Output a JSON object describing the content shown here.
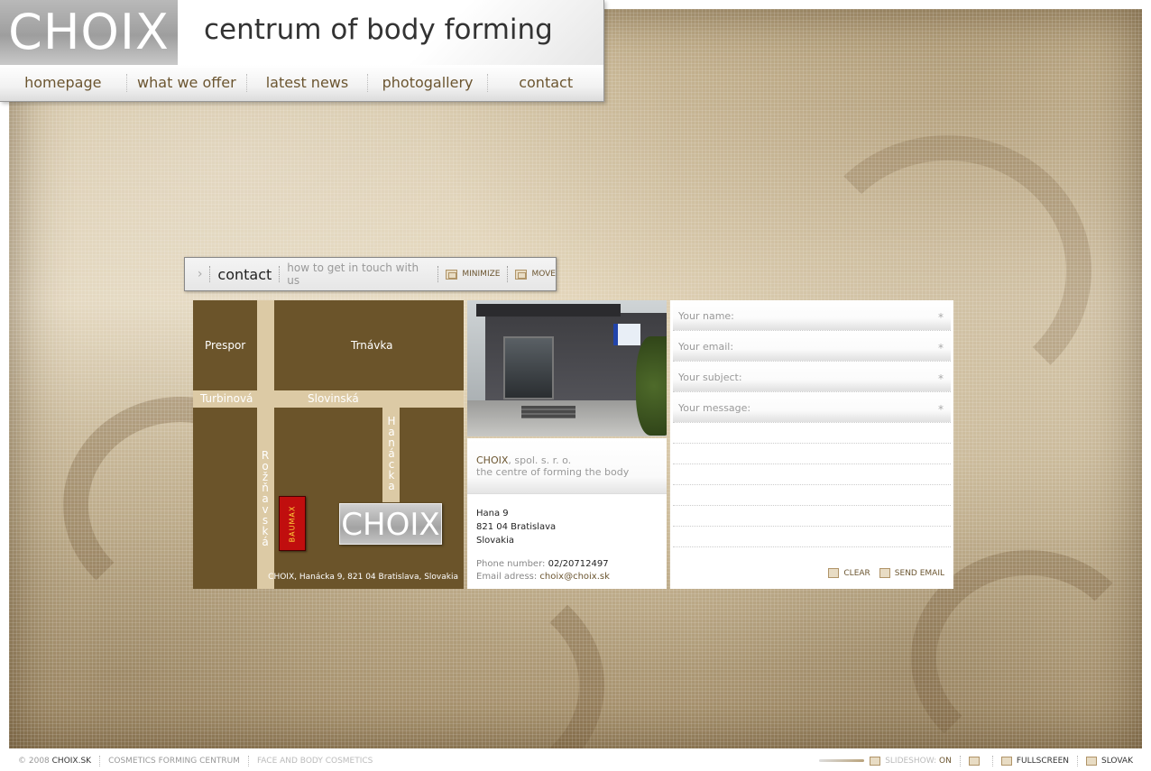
{
  "header": {
    "logo": "CHOIX",
    "tagline": "centrum of body forming"
  },
  "nav": {
    "items": [
      "homepage",
      "what we offer",
      "latest news",
      "photogallery",
      "contact"
    ]
  },
  "panel": {
    "title": "contact",
    "subtitle": "how to get in touch with us",
    "minimize_label": "MINIMIZE",
    "move_label": "MOVE"
  },
  "map": {
    "areas": [
      "Prespor",
      "Trnávka"
    ],
    "streets": [
      "Turbinová",
      "Slovinská",
      "Hanácka",
      "Rožňavská"
    ],
    "baumax": "BAUMAX",
    "logo": "CHOIX",
    "address": "CHOIX, Hanácka 9, 821 04 Bratislava, Slovakia"
  },
  "info": {
    "brand": "CHOIX",
    "company_suffix": ", spol. s. r. o.",
    "slogan": "the centre of forming the body",
    "street": "Hana 9",
    "city": "821 04 Bratislava",
    "country": "Slovakia",
    "phone_label": "Phone number:",
    "phone": "02/20712497",
    "email_label": "Email adress:",
    "email": "choix@choix.sk"
  },
  "form": {
    "name_placeholder": "Your name:",
    "email_placeholder": "Your email:",
    "subject_placeholder": "Your subject:",
    "message_placeholder": "Your message:",
    "required_mark": "*",
    "clear_label": "CLEAR",
    "send_label": "SEND EMAIL"
  },
  "footer": {
    "copyright": "© 2008",
    "site": "CHOIX.SK",
    "link1": "COSMETICS FORMING CENTRUM",
    "link2": "FACE AND BODY COSMETICS",
    "slideshow_label": "SLIDESHOW:",
    "slideshow_state": "ON",
    "fullscreen_label": "FULLSCREEN",
    "language_label": "SLOVAK"
  },
  "colors": {
    "accent_brown": "#6b5530",
    "map_brown": "#6b542a",
    "road": "#dccaa5",
    "baumax_red": "#c00e0e"
  }
}
